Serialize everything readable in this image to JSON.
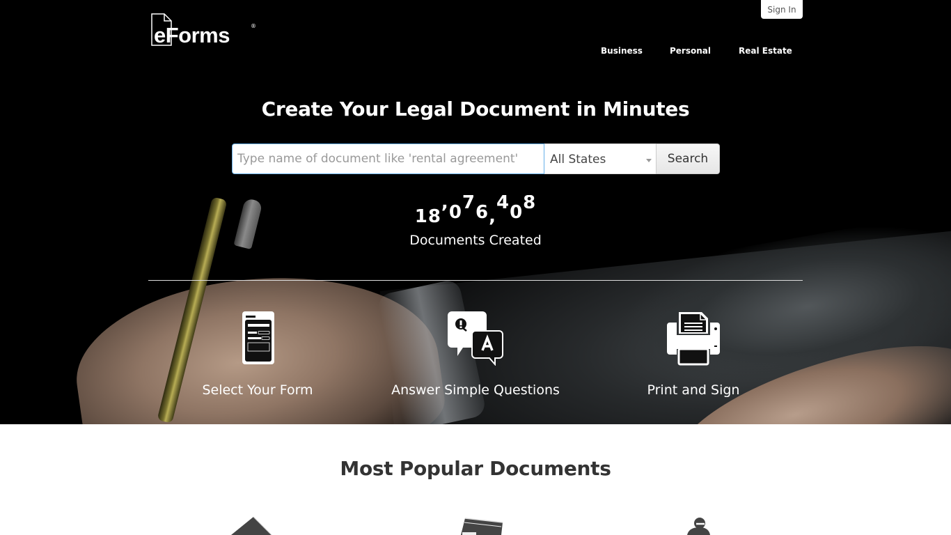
{
  "header": {
    "logo_text": "eForms",
    "logo_mark": "®",
    "sign_in_label": "Sign In",
    "nav": [
      {
        "label": "Business"
      },
      {
        "label": "Personal"
      },
      {
        "label": "Real Estate"
      }
    ]
  },
  "hero": {
    "title": "Create Your Legal Document in Minutes",
    "search": {
      "placeholder": "Type name of document like 'rental agreement'",
      "value": "",
      "state_selected": "All States",
      "button_label": "Search"
    },
    "counter": {
      "value": "18,076,408",
      "label": "Documents Created"
    },
    "steps": [
      {
        "icon": "form-icon",
        "label": "Select Your Form"
      },
      {
        "icon": "question-answer-icon",
        "label": "Answer Simple Questions"
      },
      {
        "icon": "printer-icon",
        "label": "Print and Sign"
      }
    ]
  },
  "popular": {
    "title": "Most Popular Documents",
    "icons": [
      "house-icon",
      "book-icon",
      "person-icon"
    ]
  },
  "colors": {
    "hero_bg": "#000000",
    "input_focus_border": "#66afe9",
    "popular_title": "#333333",
    "popular_icon": "#444444"
  }
}
